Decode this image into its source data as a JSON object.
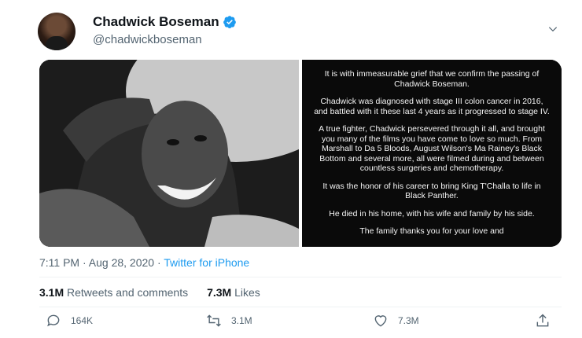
{
  "tweet": {
    "author_name": "Chadwick Boseman",
    "author_handle": "@chadwickboseman",
    "statement_paragraphs": [
      "It is with immeasurable grief that we confirm the passing of Chadwick Boseman.",
      "Chadwick was diagnosed with stage III colon cancer in 2016, and battled with it these last 4 years as it progressed to stage IV.",
      "A true fighter, Chadwick persevered through it all, and brought you many of the films you have come to love so much. From Marshall to Da 5 Bloods, August Wilson's Ma Rainey's Black Bottom and several more, all were filmed during and between countless surgeries and chemotherapy.",
      "It was the honor of his career to bring King T'Challa to life in Black Panther.",
      "He died in his home, with his wife and family by his side.",
      "The family thanks you for your love and"
    ],
    "time": "7:11 PM",
    "date": "Aug 28, 2020",
    "source": "Twitter for iPhone",
    "retweets_count": "3.1M",
    "retweets_label": "Retweets and comments",
    "likes_count": "7.3M",
    "likes_label": "Likes"
  },
  "actions": {
    "reply_count": "164K",
    "retweet_count": "3.1M",
    "like_count": "7.3M"
  },
  "icons": {
    "verified": "verified-badge-icon",
    "chevron": "chevron-down-icon",
    "reply": "reply-icon",
    "retweet": "retweet-icon",
    "like": "heart-icon",
    "share": "share-icon"
  },
  "colors": {
    "accent": "#1d9bf0",
    "secondary_text": "#536471"
  }
}
